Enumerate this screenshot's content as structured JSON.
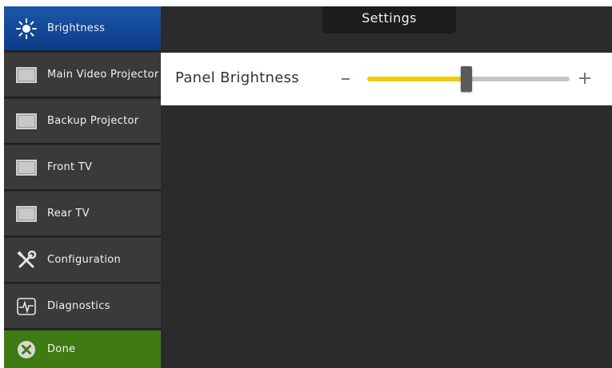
{
  "header": {
    "title": "Settings"
  },
  "sidebar": {
    "items": [
      {
        "label": "Brightness",
        "icon": "brightness-icon",
        "state": "active"
      },
      {
        "label": "Main Video Projector",
        "icon": "display-icon"
      },
      {
        "label": "Backup Projector",
        "icon": "display-icon"
      },
      {
        "label": "Front TV",
        "icon": "display-icon"
      },
      {
        "label": "Rear TV",
        "icon": "display-icon"
      },
      {
        "label": "Configuration",
        "icon": "tools-icon"
      },
      {
        "label": "Diagnostics",
        "icon": "diagnostics-icon"
      },
      {
        "label": "Done",
        "icon": "close-circle-icon",
        "state": "done"
      }
    ]
  },
  "main": {
    "setting": {
      "label": "Panel Brightness",
      "minus_label": "−",
      "plus_label": "+",
      "value_fraction": 0.49
    }
  },
  "colors": {
    "active": "#1c56a8",
    "done": "#3f7b12",
    "slider_fill": "#f2cc00",
    "background": "#2b2b2b"
  }
}
